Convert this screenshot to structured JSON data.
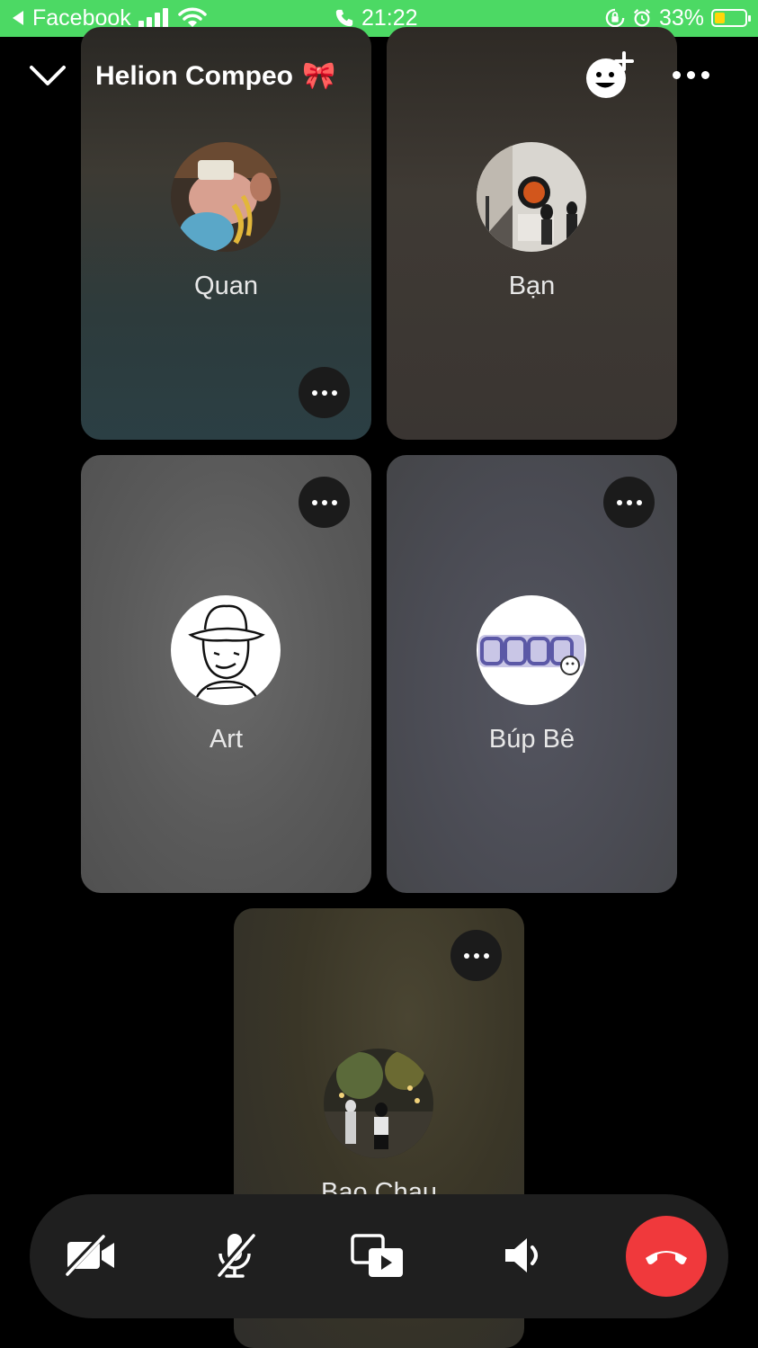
{
  "status_bar": {
    "back_app": "Facebook",
    "time": "21:22",
    "battery": "33%",
    "battery_level": 0.33
  },
  "header": {
    "title": "Helion Compeo",
    "title_emoji": "🎀",
    "icons": [
      "chevron-down-icon",
      "add-people-icon",
      "more-icon"
    ]
  },
  "participants": [
    {
      "name": "Quan"
    },
    {
      "name": "Bạn"
    },
    {
      "name": "Art"
    },
    {
      "name": "Búp Bê"
    },
    {
      "name": "Bao Chau"
    }
  ],
  "controls": {
    "icons": [
      "camera-off-icon",
      "mic-off-icon",
      "share-screen-icon",
      "speaker-icon",
      "end-call-icon"
    ],
    "end_call_color": "#f0393c"
  },
  "colors": {
    "status_bar": "#4cd964",
    "control_bar": "#1f1f1f"
  }
}
